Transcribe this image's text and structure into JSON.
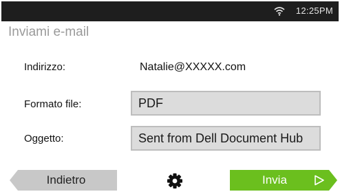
{
  "status_bar": {
    "time": "12:25PM",
    "wifi_icon": "wifi-icon"
  },
  "page": {
    "title": "Inviami e-mail"
  },
  "form": {
    "address_label": "Indirizzo:",
    "address_value": "Natalie@XXXXX.com",
    "format_label": "Formato file:",
    "format_value": "PDF",
    "subject_label": "Oggetto:",
    "subject_value": "Sent from Dell Document Hub"
  },
  "footer": {
    "back_label": "Indietro",
    "settings_icon": "gear-icon",
    "send_label": "Invia",
    "send_icon": "play-outline-icon"
  },
  "colors": {
    "status_bar": "#1e1e1e",
    "send_button": "#6bbf1e",
    "back_button": "#c8c8c8",
    "field_background": "#dcdcdc",
    "title_text": "#9a9a9a"
  }
}
